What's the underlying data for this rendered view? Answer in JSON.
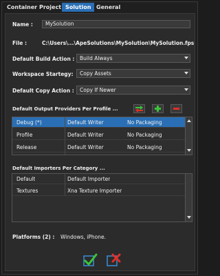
{
  "tabs": [
    {
      "label": "Container"
    },
    {
      "label": "Project"
    },
    {
      "label": "Solution"
    },
    {
      "label": "General"
    }
  ],
  "form": {
    "name_label": "Name :",
    "name_value": "MySolution",
    "file_label": "File :",
    "file_value": "C:\\Users\\...\\ApeSolutions\\MySolution\\MySolution.fps",
    "build_action_label": "Default Build Action :",
    "build_action_value": "Build Always",
    "workspace_label": "Workspace Startegy:",
    "workspace_value": "Copy Assets",
    "copy_action_label": "Default Copy Action :",
    "copy_action_value": "Copy If Newer"
  },
  "output_providers": {
    "label": "Default Output Providers Per Profile ...",
    "rows": [
      {
        "profile": "Debug (*)",
        "writer": "Default Writer",
        "packaging": "No Packaging"
      },
      {
        "profile": "Profile",
        "writer": "Default Writer",
        "packaging": "No Packaging"
      },
      {
        "profile": "Release",
        "writer": "Default Writer",
        "packaging": "No Packaging"
      }
    ]
  },
  "importers": {
    "label": "Default Importers Per Category ...",
    "rows": [
      {
        "category": "Default",
        "importer": "Default Importer"
      },
      {
        "category": "Textures",
        "importer": "Xna Texture Importer"
      }
    ]
  },
  "platforms": {
    "label": "Platforms (2) :",
    "value": "Windows, iPhone."
  },
  "colors": {
    "accent": "#2a6fb5",
    "panel": "#2b2b2b",
    "ok_green": "#3cc43c",
    "cancel_red": "#e0302a"
  },
  "icons": [
    "swap-icon",
    "add-icon",
    "remove-icon",
    "ok-check-icon",
    "cancel-icon"
  ]
}
